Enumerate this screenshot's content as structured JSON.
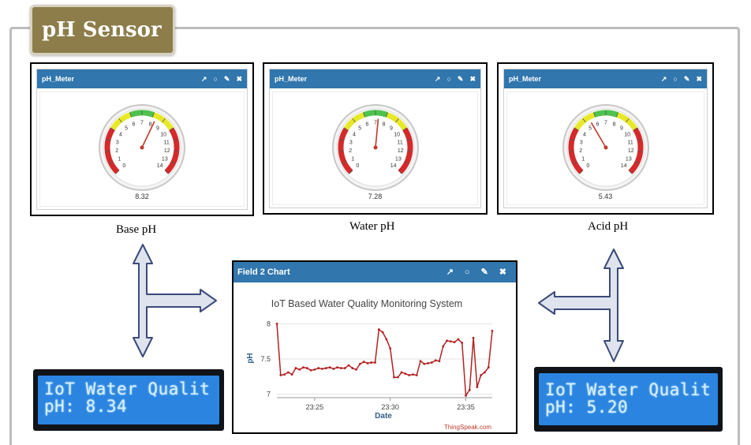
{
  "title": "pH Sensor",
  "gauges": [
    {
      "header": "pH_Meter",
      "value": 8.32,
      "value_text": "8.32",
      "label": "Base pH"
    },
    {
      "header": "pH_Meter",
      "value": 7.28,
      "value_text": "7.28",
      "label": "Water pH"
    },
    {
      "header": "pH_Meter",
      "value": 5.43,
      "value_text": "5.43",
      "label": "Acid pH"
    }
  ],
  "gauge_ticks": [
    "0",
    "1",
    "2",
    "3",
    "4",
    "5",
    "6",
    "7",
    "8",
    "9",
    "10",
    "11",
    "12",
    "13",
    "14"
  ],
  "gauge_colors": {
    "acid": "#d42a2a",
    "mid": "#e8e82a",
    "neutral": "#4dc24d",
    "needle": "#c0392b"
  },
  "chart": {
    "header": "Field 2 Chart",
    "credit": "ThingSpeak.com",
    "chart_data": {
      "type": "line",
      "title": "IoT Based Water Quality Monitoring System",
      "xlabel": "Date",
      "ylabel": "pH",
      "x_ticks": [
        "23:25",
        "23:30",
        "23:35"
      ],
      "y_ticks": [
        7,
        7.5,
        8
      ],
      "ylim": [
        6.95,
        8.05
      ],
      "grid": true,
      "series": [
        {
          "color": "#b22222",
          "values": [
            8.0,
            7.27,
            7.28,
            7.31,
            7.28,
            7.37,
            7.35,
            7.38,
            7.37,
            7.34,
            7.35,
            7.37,
            7.36,
            7.37,
            7.38,
            7.36,
            7.38,
            7.37,
            7.37,
            7.41,
            7.37,
            7.35,
            7.43,
            7.46,
            7.44,
            7.45,
            7.45,
            7.92,
            7.88,
            7.78,
            7.65,
            7.24,
            7.24,
            7.31,
            7.29,
            7.27,
            7.28,
            7.27,
            7.47,
            7.43,
            7.44,
            7.45,
            7.48,
            7.47,
            7.68,
            7.76,
            7.75,
            7.74,
            7.78,
            7.73,
            6.98,
            7.06,
            7.8,
            7.1,
            7.27,
            7.31,
            7.38,
            7.9
          ]
        }
      ]
    }
  },
  "lcds": [
    {
      "line1": "IoT Water Qualit",
      "line2": "pH: 8.34"
    },
    {
      "line1": "IoT Water Qualit",
      "line2": "pH: 5.20"
    }
  ]
}
